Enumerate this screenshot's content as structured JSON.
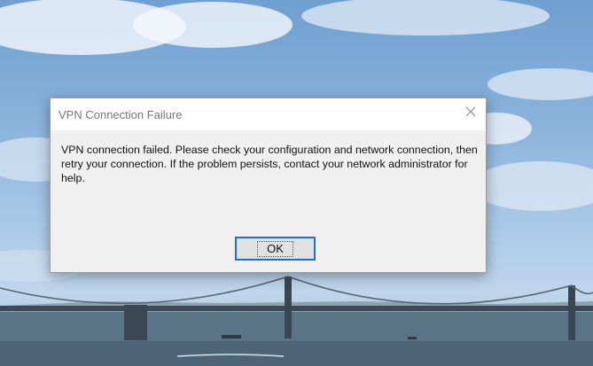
{
  "dialog": {
    "title": "VPN Connection Failure",
    "message": "VPN connection failed. Please check your configuration and network connection, then retry your connection. If the problem persists, contact your network administrator for help.",
    "ok_label": "OK",
    "close_icon": "close-icon"
  },
  "wallpaper": {
    "subject": "bridge-over-bay",
    "sky_color": "#8bb4dc",
    "water_color": "#5a7487"
  }
}
